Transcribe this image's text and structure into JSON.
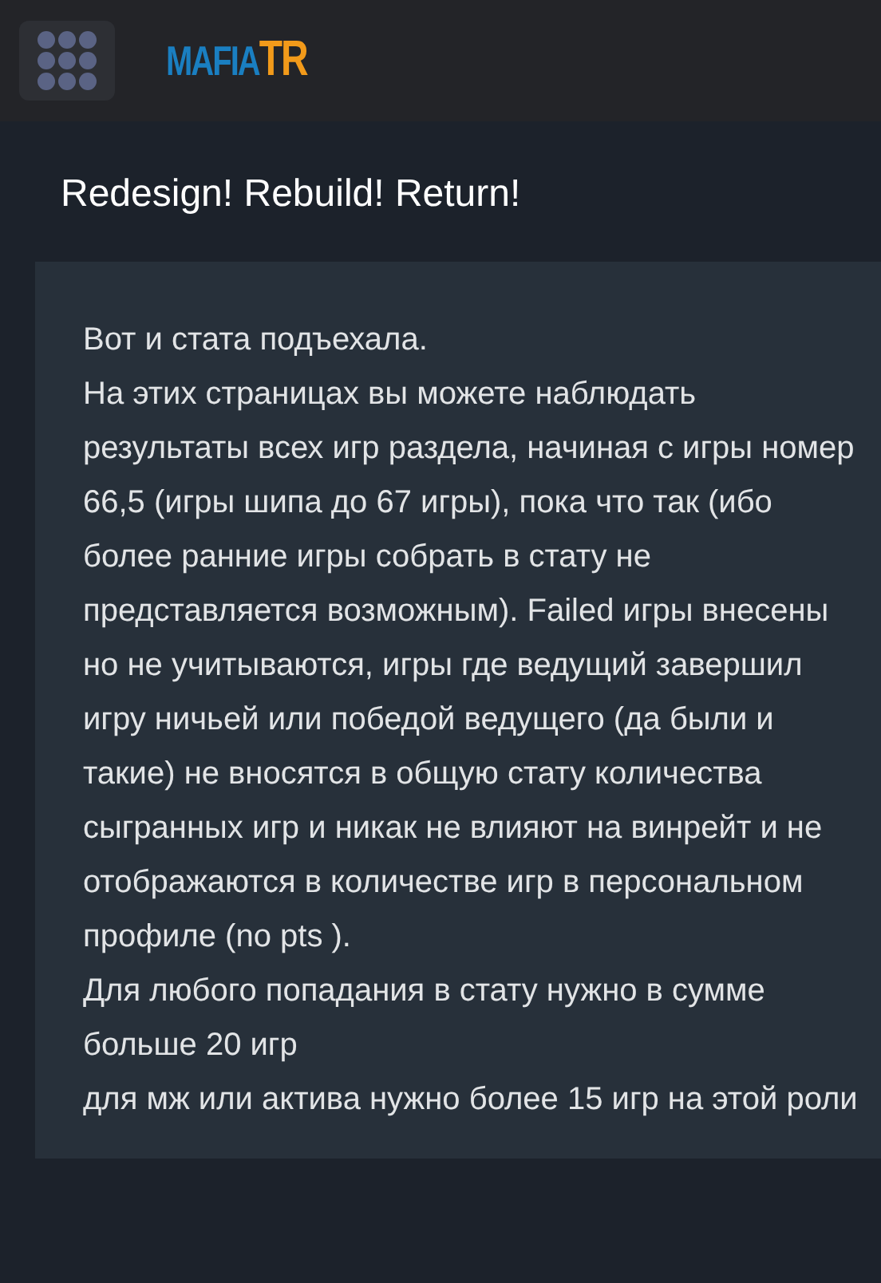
{
  "header": {
    "logo": {
      "part1": "MAFIA",
      "part2": "TR"
    }
  },
  "post": {
    "title": "Redesign! Rebuild! Return!",
    "paragraphs": [
      "Вот и стата подъехала.",
      "На этих страницах вы можете наблюдать результаты всех игр раздела, начиная с игры номер 66,5 (игры шипа до 67 игры), пока что так (ибо более ранние игры собрать в стату не представляется возможным). Failed игры внесены но не учитываются, игры где ведущий завершил игру ничьей или победой ведущего (да были и такие) не вносятся в общую стату количества сыгранных игр и никак не влияют на винрейт и не отображаются в количестве игр в персональном профиле (no pts ).",
      "Для любого попадания в стату нужно в сумме больше 20 игр",
      "для мж или актива нужно более 15 игр на этой роли"
    ]
  }
}
